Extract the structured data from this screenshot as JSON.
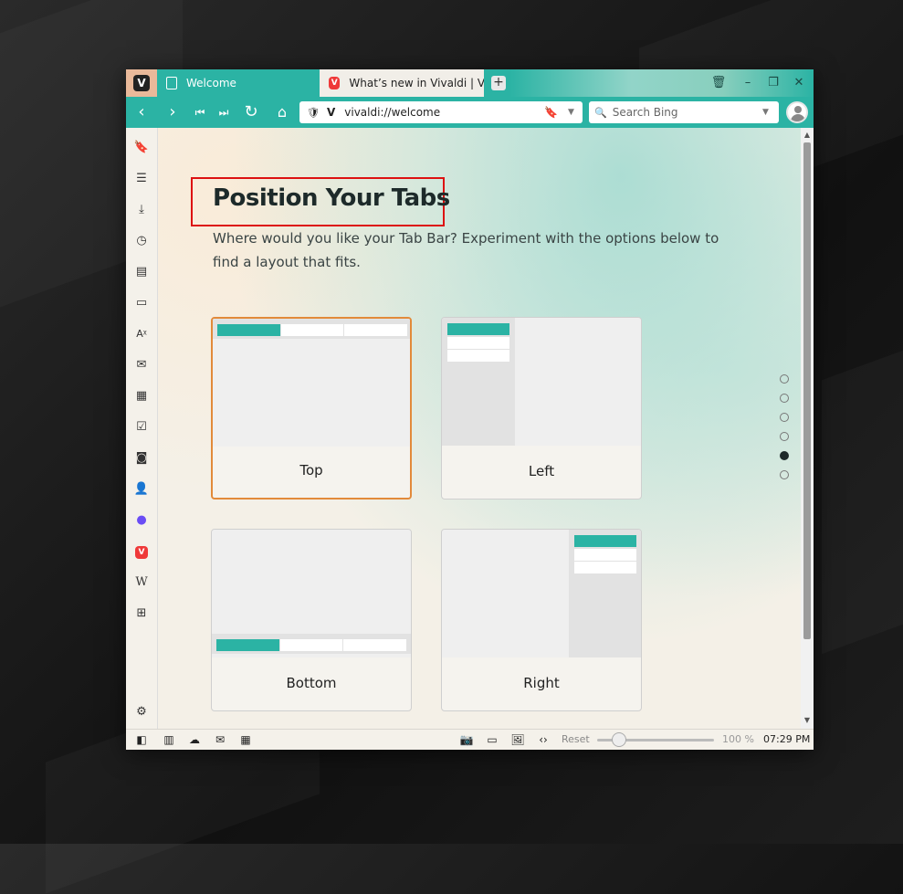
{
  "window": {
    "tabs": [
      {
        "title": "Welcome",
        "active": true,
        "icon": "document-icon"
      },
      {
        "title": "What’s new in Vivaldi | Viva",
        "active": false,
        "icon": "vivaldi-icon"
      }
    ],
    "address": {
      "url": "vivaldi://welcome"
    },
    "search": {
      "placeholder": "Search Bing"
    }
  },
  "page": {
    "title": "Position Your Tabs",
    "description": "Where would you like your Tab Bar? Experiment with the options below to find a layout that fits.",
    "options": [
      {
        "label": "Top",
        "selected": true
      },
      {
        "label": "Left",
        "selected": false
      },
      {
        "label": "Bottom",
        "selected": false
      },
      {
        "label": "Right",
        "selected": false
      }
    ],
    "steps": {
      "count": 6,
      "current": 5
    }
  },
  "statusbar": {
    "reset_label": "Reset",
    "zoom": "100 %",
    "time": "07:29 PM"
  },
  "colors": {
    "accent": "#2bb3a4",
    "selected_border": "#e28a3a",
    "highlight_box": "#dd1111"
  }
}
